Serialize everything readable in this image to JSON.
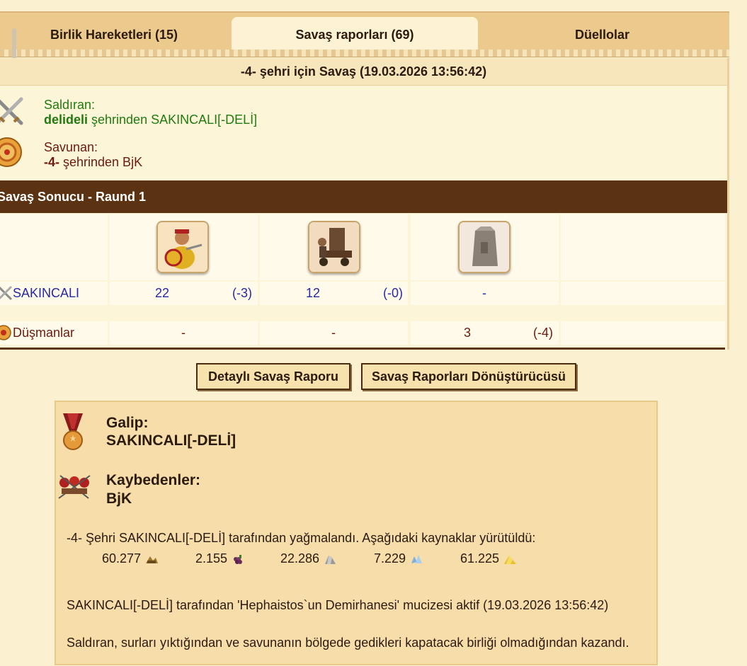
{
  "tabs": [
    {
      "label": "Birlik Hareketleri (15)"
    },
    {
      "label": "Savaş raporları (69)"
    },
    {
      "label": "Düellolar"
    }
  ],
  "battle": {
    "title": "-4- şehri için Savaş (19.03.2026 13:56:42)",
    "attacker_label": "Saldıran:",
    "attacker_city": "delideli",
    "attacker_rest": " şehrinden SAKINCALI[-DELİ]",
    "defender_label": "Savunan:",
    "defender_city": "-4-",
    "defender_rest": " şehrinden BjK",
    "round_title": "Savaş Sonucu - Raund 1"
  },
  "units_table": {
    "attacker_name": "SAKINCALI",
    "defender_name": "Düşmanlar",
    "attacker_row": [
      {
        "count": "22",
        "loss": "(-3)"
      },
      {
        "count": "12",
        "loss": "(-0)"
      },
      {
        "count": "-",
        "loss": ""
      }
    ],
    "defender_row": [
      {
        "count": "-",
        "loss": ""
      },
      {
        "count": "-",
        "loss": ""
      },
      {
        "count": "3",
        "loss": "(-4)"
      }
    ]
  },
  "buttons": {
    "detail": "Detaylı Savaş Raporu",
    "converter": "Savaş Raporları Dönüştürücüsü"
  },
  "result": {
    "winner_label": "Galip:",
    "winner_name": "SAKINCALI[-DELİ]",
    "loser_label": "Kaybedenler:",
    "loser_name": "BjK",
    "plunder_text": "-4- Şehri SAKINCALI[-DELİ] tarafından yağmalandı. Aşağıdaki kaynaklar yürütüldü:",
    "resources": [
      {
        "value": "60.277",
        "icon": "wood-icon"
      },
      {
        "value": "2.155",
        "icon": "wine-icon"
      },
      {
        "value": "22.286",
        "icon": "marble-icon"
      },
      {
        "value": "7.229",
        "icon": "crystal-icon"
      },
      {
        "value": "61.225",
        "icon": "sulfur-icon"
      }
    ],
    "miracle_text": "SAKINCALI[-DELİ] tarafından 'Hephaistos`un Demirhanesi' mucizesi aktif (19.03.2026 13:56:42)",
    "reason_text": "Saldıran, surları yıktığından ve savunanın bölgede gedikleri kapatacak birliği olmadığından kazandı."
  },
  "colors": {
    "background": "#fbf0cf",
    "round_bar": "#5b3212",
    "attacker_green": "#217a10",
    "defender_maroon": "#6b1a10",
    "link_blue": "#2828a8"
  }
}
